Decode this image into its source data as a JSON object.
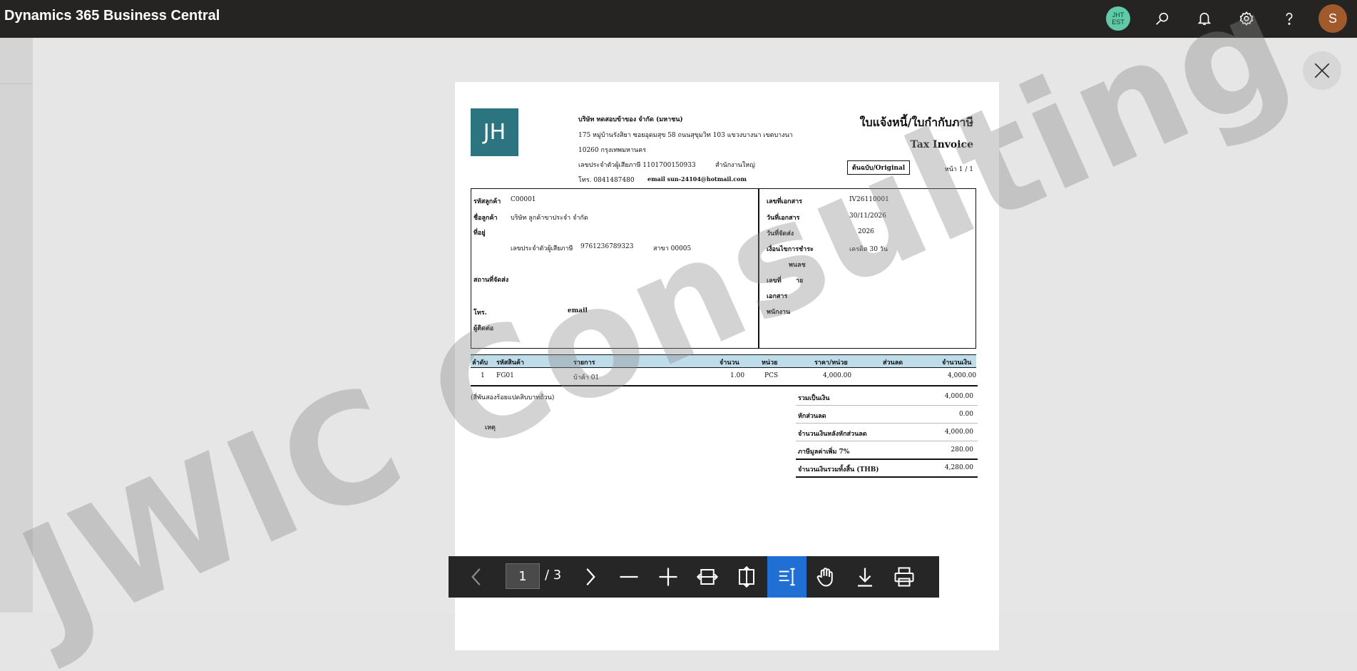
{
  "app": {
    "title": "Dynamics 365 Business Central",
    "company_badge_line1": "JHT",
    "company_badge_line2": "EST",
    "avatar_letter": "S"
  },
  "icons": {
    "search": "search-icon",
    "notifications": "bell-icon",
    "settings": "gear-icon",
    "help": "question-icon",
    "close": "close-icon"
  },
  "colors": {
    "topbar": "#252423",
    "logo": "#2b7480",
    "table_header": "#bfdcea",
    "active_tool": "#1f6fd4"
  },
  "watermark": "JWIC Consulting",
  "invoice": {
    "logo_text": "JH",
    "company": {
      "name": "บริษัท ทดสอบข้าของ จำกัด (มหาชน)",
      "address1": "175 หมู่บ้านรังสิยา ซอยอุดมสุข 58 ถนนสุขุมวิท 103 แขวงบางนา เขตบางนา",
      "address2": "10260 กรุงเทพมหานคร",
      "tax_id": "เลขประจำตัวผู้เสียภาษี 1101700150933",
      "branch": "สำนักงานใหญ่",
      "phone": "โทร. 0841487480",
      "email": "email sun-24104@hotmail.com"
    },
    "title_th": "ใบแจ้งหนี้/ใบกำกับภาษี",
    "title_en": "Tax Invoice",
    "copy_label": "ต้นฉบับ/Original",
    "page_label": "หน้า 1 / 1",
    "customer": {
      "code_label": "รหัสลูกค้า",
      "code": "C00001",
      "name_label": "ชื่อลูกค้า",
      "name": "บริษัท ลูกค้าขาประจำ จำกัด",
      "address_label": "ที่อยู่",
      "tax_label": "เลขประจำตัวผู้เสียภาษี",
      "tax_id": "9761236789323",
      "branch": "สาขา 00005",
      "ship_label": "สถานที่จัดส่ง",
      "phone_label": "โทร.",
      "email_label": "email",
      "contact_label": "ผู้ติดต่อ"
    },
    "doc": {
      "no_label": "เลขที่เอกสาร",
      "no": "IV26110001",
      "date_label": "วันที่เอกสาร",
      "date": "30/11/2026",
      "ship_date_label": "วันที่จัดส่ง",
      "ship_date": "2026",
      "terms_label": "เงื่อนไขการชำระ",
      "terms": "เครดิต 30 วัน",
      "due_label": "พนลช",
      "ref_label": "เลขที่",
      "ref_suffix": "าย",
      "doc2_label": "เอกสาร",
      "staff_label": "พนักงาน"
    },
    "table": {
      "headers": [
        "ลำดับ",
        "รหัสสินค้า",
        "รายการ",
        "จำนวน",
        "หน่วย",
        "ราคา/หน่วย",
        "ส่วนลด",
        "จำนวนเงิน"
      ],
      "rows": [
        [
          "1",
          "FG01",
          "บ้าค้า 01",
          "1.00",
          "PCS",
          "4,000.00",
          "",
          "4,000.00"
        ]
      ]
    },
    "amount_words": "(สี่พันสองร้อยแปดสิบบาทถ้วน)",
    "remark_label": "หมายเหตุ",
    "remark_visible": "เหตุ",
    "totals": [
      {
        "label": "รวมเป็นเงิน",
        "value": "4,000.00"
      },
      {
        "label": "หักส่วนลด",
        "value": "0.00"
      },
      {
        "label": "จำนวนเงินหลังหักส่วนลด",
        "value": "4,000.00"
      },
      {
        "label": "ภาษีมูลค่าเพิ่ม 7%",
        "value": "280.00"
      },
      {
        "label": "จำนวนเงินรวมทั้งสิ้น (THB)",
        "value": "4,280.00"
      }
    ]
  },
  "pdf_toolbar": {
    "current_page": "1",
    "total_pages": "/ 3",
    "tools": [
      "prev-page-icon",
      "next-page-icon",
      "zoom-out-icon",
      "zoom-in-icon",
      "fit-width-icon",
      "fit-page-icon",
      "text-select-icon",
      "hand-pan-icon",
      "download-icon",
      "print-icon"
    ]
  }
}
